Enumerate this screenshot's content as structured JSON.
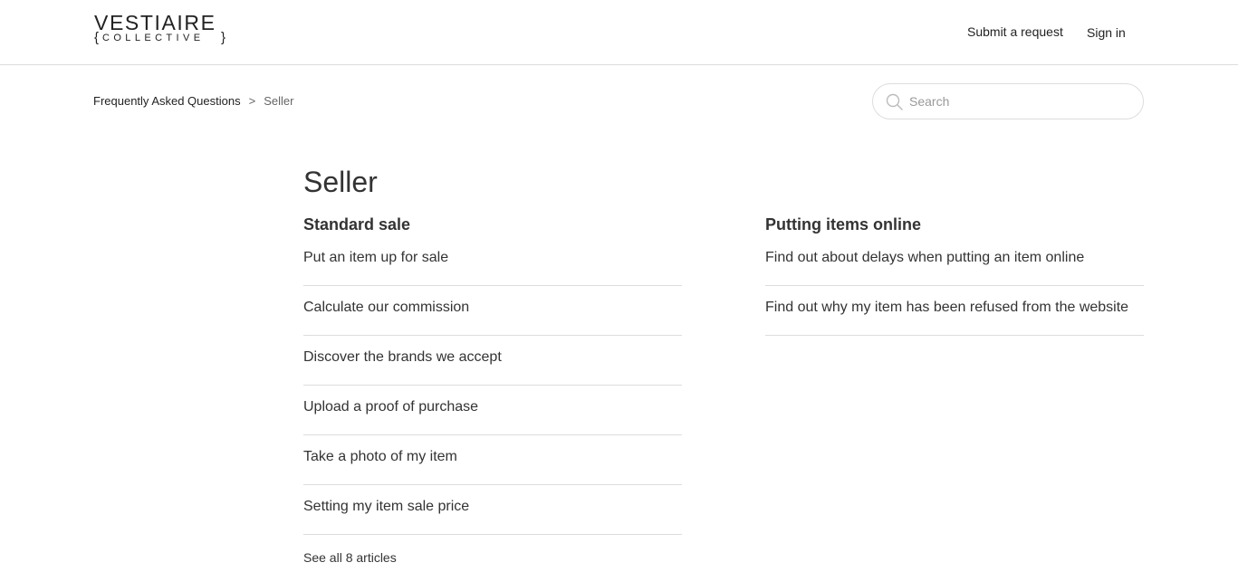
{
  "header": {
    "logo_top": "VESTIAIRE",
    "logo_bottom": "COLLECTIVE",
    "submit_request": "Submit a request",
    "sign_in": "Sign in"
  },
  "breadcrumb": {
    "home": "Frequently Asked Questions",
    "separator": ">",
    "current": "Seller"
  },
  "search": {
    "placeholder": "Search",
    "icon": "search-icon"
  },
  "page": {
    "title": "Seller"
  },
  "sections": [
    {
      "title": "Standard sale",
      "articles": [
        "Put an item up for sale",
        "Calculate our commission",
        "Discover the brands we accept",
        "Upload a proof of purchase",
        "Take a photo of my item",
        "Setting my item sale price"
      ],
      "see_all": "See all 8 articles"
    },
    {
      "title": "Putting items online",
      "articles": [
        "Find out about delays when putting an item online",
        "Find out why my item has been refused from the website"
      ]
    }
  ],
  "colors": {
    "text": "#333333",
    "divider": "#dddddd",
    "muted": "#666666"
  }
}
